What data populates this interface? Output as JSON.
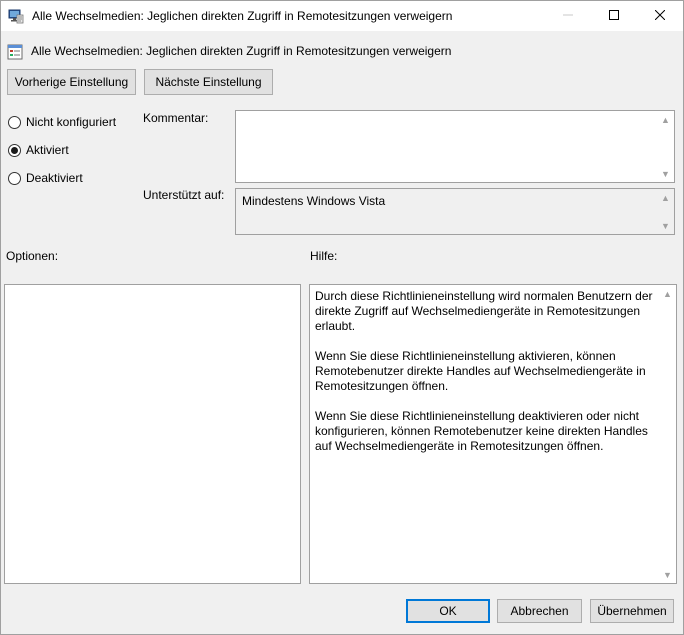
{
  "window": {
    "title": "Alle Wechselmedien: Jeglichen direkten Zugriff in Remotesitzungen verweigern",
    "controls": {
      "minimize": "─",
      "maximize": "☐",
      "close": "✕"
    }
  },
  "header": {
    "title": "Alle Wechselmedien: Jeglichen direkten Zugriff in Remotesitzungen verweigern"
  },
  "nav": {
    "prev_label": "Vorherige Einstellung",
    "next_label": "Nächste Einstellung"
  },
  "state": {
    "options": [
      {
        "label": "Nicht konfiguriert",
        "checked": false
      },
      {
        "label": "Aktiviert",
        "checked": true
      },
      {
        "label": "Deaktiviert",
        "checked": false
      }
    ]
  },
  "comment": {
    "label": "Kommentar:",
    "value": ""
  },
  "supported": {
    "label": "Unterstützt auf:",
    "value": "Mindestens Windows Vista"
  },
  "options_panel": {
    "label": "Optionen:"
  },
  "help_panel": {
    "label": "Hilfe:",
    "paragraphs": [
      "Durch diese Richtlinieneinstellung wird normalen Benutzern der direkte Zugriff auf Wechselmediengeräte in Remotesitzungen erlaubt.",
      "Wenn Sie diese Richtlinieneinstellung aktivieren, können Remotebenutzer direkte Handles auf Wechselmediengeräte in Remotesitzungen öffnen.",
      "Wenn Sie diese Richtlinieneinstellung deaktivieren oder nicht konfigurieren, können Remotebenutzer keine direkten Handles auf Wechselmediengeräte in Remotesitzungen öffnen."
    ]
  },
  "footer": {
    "ok_label": "OK",
    "cancel_label": "Abbrechen",
    "apply_label": "Übernehmen"
  },
  "colors": {
    "accent": "#0078d7",
    "window_bg": "#f0f0f0",
    "border": "#a0a0a0"
  },
  "icons": {
    "title": "policy-monitor-icon",
    "header": "policy-setting-icon"
  }
}
